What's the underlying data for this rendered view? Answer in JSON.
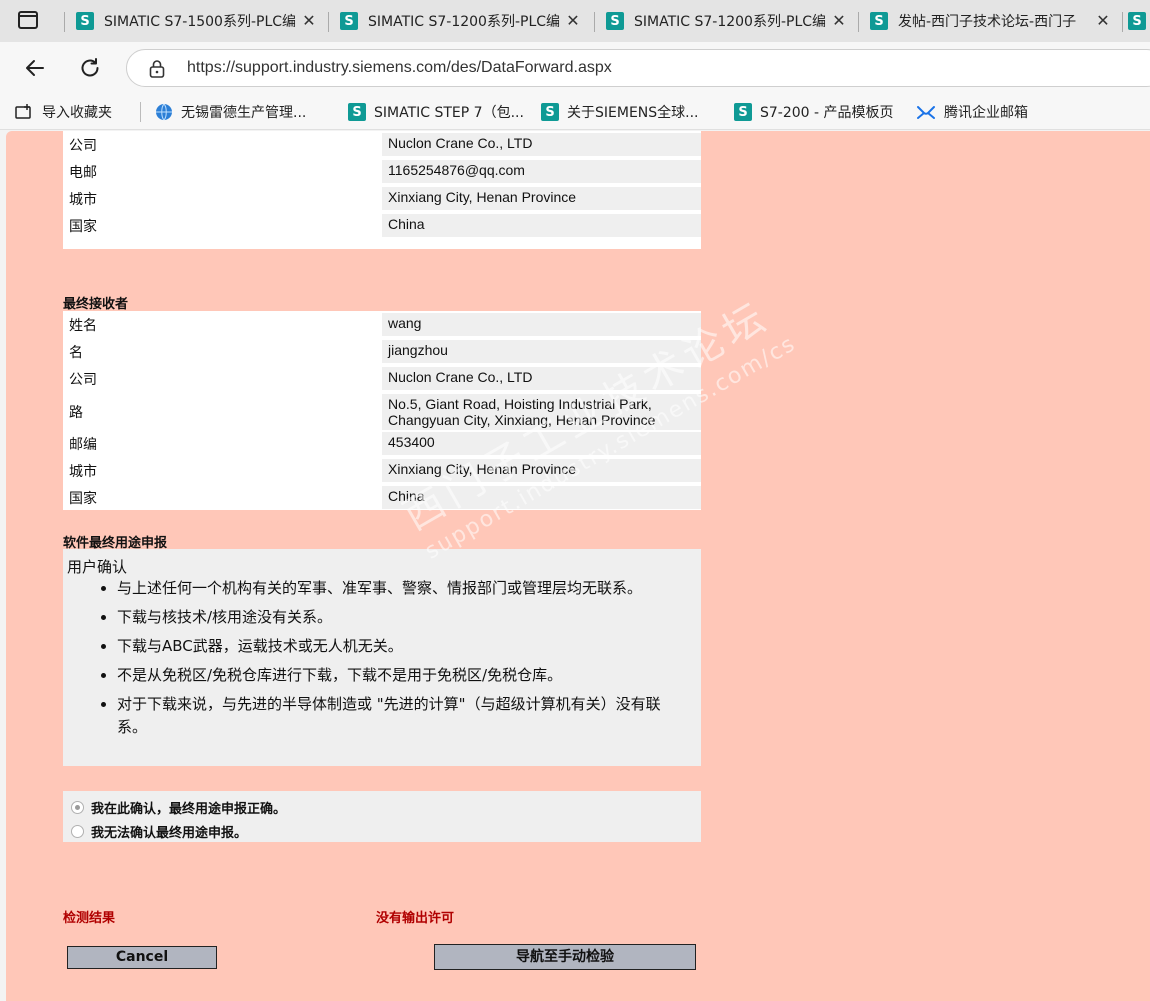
{
  "browser": {
    "tabs": [
      {
        "title": "SIMATIC S7-1500系列-PLC编"
      },
      {
        "title": "SIMATIC S7-1200系列-PLC编"
      },
      {
        "title": "SIMATIC S7-1200系列-PLC编"
      },
      {
        "title": "发帖-西门子技术论坛-西门子"
      }
    ],
    "favicon_letter": "S",
    "close_glyph": "✕",
    "url": "https://support.industry.siemens.com/des/DataForward.aspx",
    "bookmarks": [
      {
        "label": "导入收藏夹",
        "icon": "import-icon"
      },
      {
        "label": "无锡雷德生产管理...",
        "icon": "globe-icon"
      },
      {
        "label": "SIMATIC STEP 7（包...",
        "icon": "siemens-icon"
      },
      {
        "label": "关于SIEMENS全球...",
        "icon": "siemens-icon"
      },
      {
        "label": "S7-200 - 产品模板页",
        "icon": "siemens-icon"
      },
      {
        "label": "腾讯企业邮箱",
        "icon": "mail-icon"
      }
    ]
  },
  "applicant": {
    "rows": [
      {
        "label": "公司",
        "value": "Nuclon Crane Co., LTD"
      },
      {
        "label": "电邮",
        "value": "1165254876@qq.com"
      },
      {
        "label": "城市",
        "value": "Xinxiang City, Henan Province"
      },
      {
        "label": "国家",
        "value": "China"
      }
    ]
  },
  "final_recipient": {
    "title": "最终接收者",
    "rows": [
      {
        "label": "姓名",
        "value": "wang"
      },
      {
        "label": "名",
        "value": "jiangzhou"
      },
      {
        "label": "公司",
        "value": "Nuclon Crane Co., LTD"
      },
      {
        "label": "路",
        "value": "No.5, Giant Road, Hoisting Industrial Park, Changyuan City, Xinxiang, Henan Province"
      },
      {
        "label": "邮编",
        "value": "453400"
      },
      {
        "label": "城市",
        "value": "Xinxiang City, Henan Province"
      },
      {
        "label": "国家",
        "value": "China"
      }
    ]
  },
  "end_use": {
    "title": "软件最终用途申报",
    "heading": "用户确认",
    "items": [
      "与上述任何一个机构有关的军事、准军事、警察、情报部门或管理层均无联系。",
      "下载与核技术/核用途没有关系。",
      "下载与ABC武器，运载技术或无人机无关。",
      "不是从免税区/免税仓库进行下载，下载不是用于免税区/免税仓库。",
      "对于下载来说，与先进的半导体制造或 \"先进的计算\"（与超级计算机有关）没有联系。"
    ]
  },
  "confirmation": {
    "options": [
      {
        "label": "我在此确认，最终用途申报正确。",
        "checked": true
      },
      {
        "label": "我无法确认最终用途申报。",
        "checked": false
      }
    ]
  },
  "result": {
    "label": "检测结果",
    "value": "没有输出许可"
  },
  "buttons": {
    "cancel": "Cancel",
    "manual_check": "导航至手动检验"
  },
  "watermark": {
    "line1": "西门子工业技术论坛",
    "line2": "support.industry.siemens.com/cs"
  }
}
